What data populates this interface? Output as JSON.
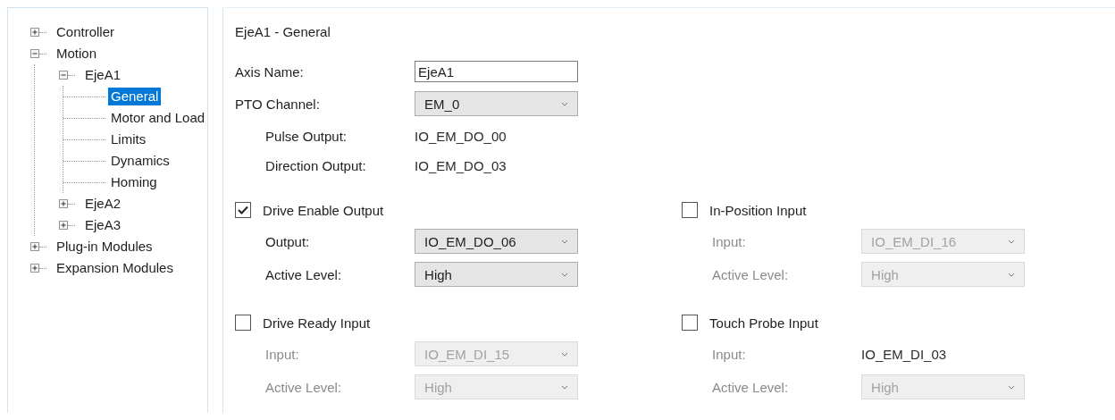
{
  "tree": [
    {
      "label": "Controller",
      "expanded": false,
      "selected": false
    },
    {
      "label": "Motion",
      "expanded": true,
      "selected": false,
      "children": [
        {
          "label": "EjeA1",
          "expanded": true,
          "selected": false,
          "children": [
            {
              "label": "General",
              "selected": true
            },
            {
              "label": "Motor and Load",
              "selected": false
            },
            {
              "label": "Limits",
              "selected": false
            },
            {
              "label": "Dynamics",
              "selected": false
            },
            {
              "label": "Homing",
              "selected": false
            }
          ]
        },
        {
          "label": "EjeA2",
          "expanded": false,
          "selected": false
        },
        {
          "label": "EjeA3",
          "expanded": false,
          "selected": false
        }
      ]
    },
    {
      "label": "Plug-in Modules",
      "expanded": false,
      "selected": false
    },
    {
      "label": "Expansion Modules",
      "expanded": false,
      "selected": false
    }
  ],
  "form": {
    "title": "EjeA1 - General",
    "fields": [
      {
        "label": "Axis Name:",
        "kind": "input",
        "value": "EjeA1"
      },
      {
        "label": "PTO Channel:",
        "kind": "dropdown",
        "value": "EM_0"
      },
      {
        "label": "Pulse Output:",
        "kind": "readout",
        "value": "IO_EM_DO_00"
      },
      {
        "label": "Direction Output:",
        "kind": "readout",
        "value": "IO_EM_DO_03"
      }
    ],
    "groups": [
      {
        "label": "Drive Enable Output",
        "checked": true,
        "rows": [
          {
            "label": "Output:",
            "kind": "dropdown",
            "value": "IO_EM_DO_06",
            "disabled": false
          },
          {
            "label": "Active Level:",
            "kind": "dropdown",
            "value": "High",
            "disabled": false
          }
        ]
      },
      {
        "label": "In-Position Input",
        "checked": false,
        "rows": [
          {
            "label": "Input:",
            "kind": "dropdown",
            "value": "IO_EM_DI_16",
            "disabled": true
          },
          {
            "label": "Active Level:",
            "kind": "dropdown",
            "value": "High",
            "disabled": true
          }
        ]
      },
      {
        "label": "Drive Ready Input",
        "checked": false,
        "rows": [
          {
            "label": "Input:",
            "kind": "dropdown",
            "value": "IO_EM_DI_15",
            "disabled": true
          },
          {
            "label": "Active Level:",
            "kind": "dropdown",
            "value": "High",
            "disabled": true
          }
        ]
      },
      {
        "label": "Touch Probe Input",
        "checked": false,
        "rows": [
          {
            "label": "Input:",
            "kind": "readout",
            "value": "IO_EM_DI_03",
            "disabled": true
          },
          {
            "label": "Active Level:",
            "kind": "dropdown",
            "value": "High",
            "disabled": true
          }
        ]
      }
    ]
  }
}
